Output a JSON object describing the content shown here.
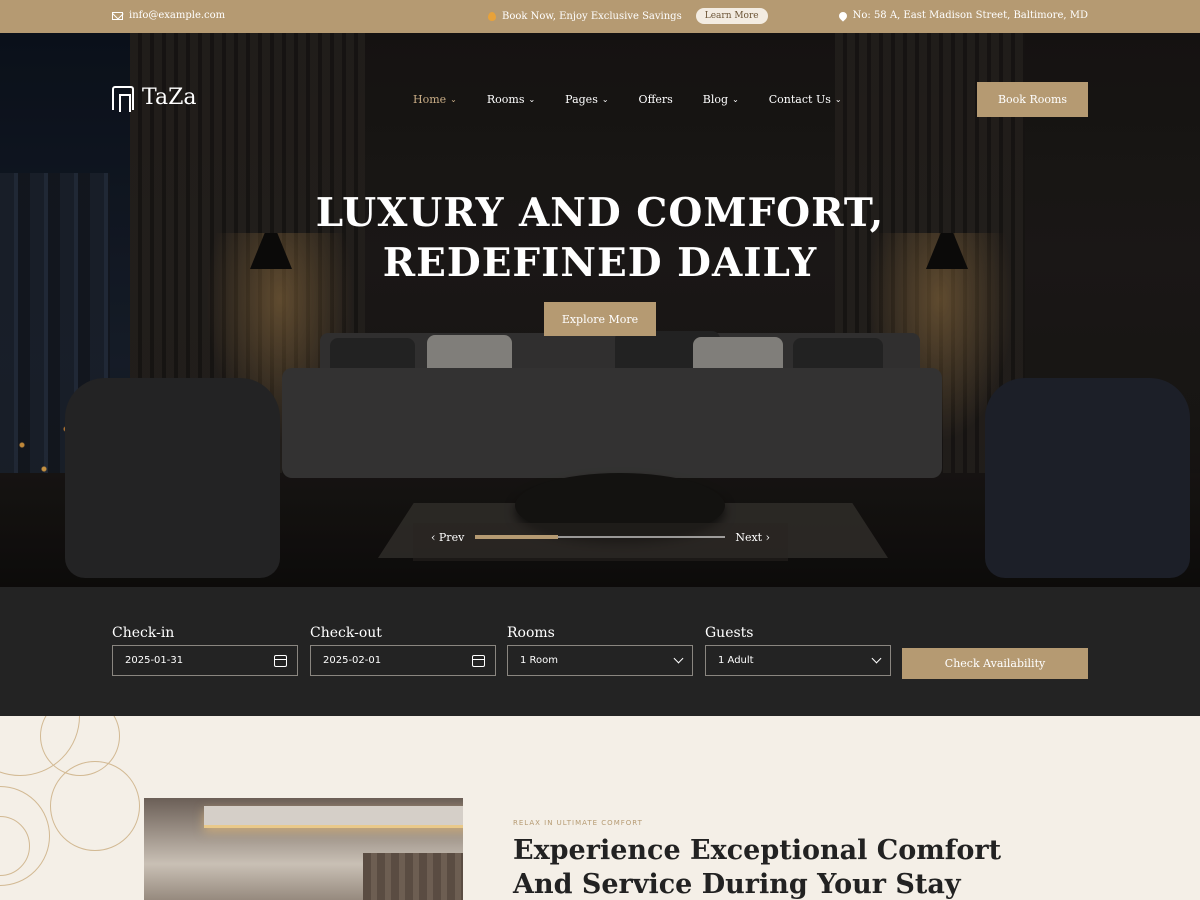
{
  "topbar": {
    "email": "info@example.com",
    "promo": "Book Now, Enjoy Exclusive Savings",
    "learn_more": "Learn More",
    "address": "No: 58 A, East Madison Street, Baltimore, MD"
  },
  "brand": {
    "name": "TaZa"
  },
  "nav": {
    "items": [
      {
        "label": "Home"
      },
      {
        "label": "Rooms"
      },
      {
        "label": "Pages"
      },
      {
        "label": "Offers"
      },
      {
        "label": "Blog"
      },
      {
        "label": "Contact Us"
      }
    ],
    "book_label": "Book Rooms"
  },
  "hero": {
    "title_line1": "LUXURY AND COMFORT,",
    "title_line2": "REDEFINED DAILY",
    "cta": "Explore More",
    "prev": "Prev",
    "next": "Next",
    "slide_progress": 0.33
  },
  "booking": {
    "checkin_label": "Check-in",
    "checkin_value": "2025-01-31",
    "checkout_label": "Check-out",
    "checkout_value": "2025-02-01",
    "rooms_label": "Rooms",
    "rooms_value": "1 Room",
    "guests_label": "Guests",
    "guests_value": "1 Adult",
    "submit": "Check Availability"
  },
  "about": {
    "kicker": "RELAX IN ULTIMATE COMFORT",
    "title": "Experience Exceptional Comfort And Service During Your Stay"
  },
  "colors": {
    "accent": "#b59a72",
    "dark": "#232323",
    "cream": "#f4efe7"
  }
}
